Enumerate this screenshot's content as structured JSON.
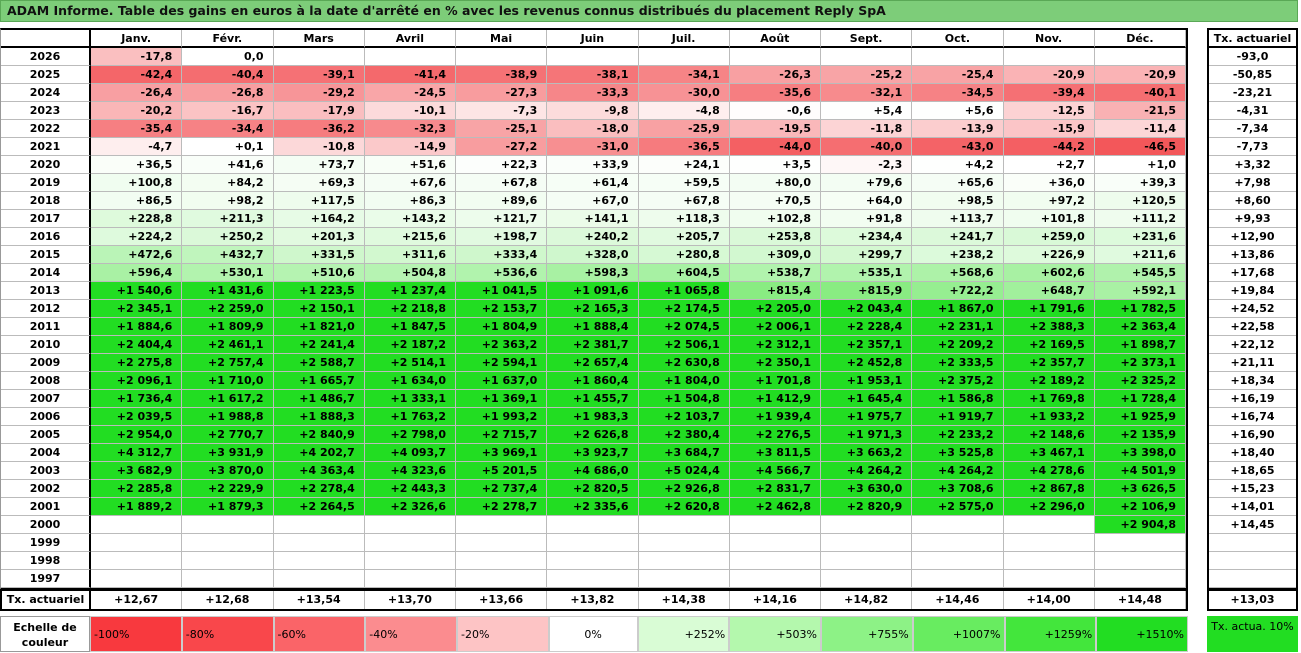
{
  "title": "ADAM Informe. Table des gains en euros à la date d'arrêté en % avec les revenus connus distribués du placement Reply SpA",
  "months": [
    "Janv.",
    "Févr.",
    "Mars",
    "Avril",
    "Mai",
    "Juin",
    "Juil.",
    "Août",
    "Sept.",
    "Oct.",
    "Nov.",
    "Déc."
  ],
  "side_header": "Tx. actuariel",
  "rows": [
    {
      "year": "2026",
      "cells": [
        "-17,8",
        "0,0",
        "",
        "",
        "",
        "",
        "",
        "",
        "",
        "",
        "",
        ""
      ],
      "rate": "-93,0"
    },
    {
      "year": "2025",
      "cells": [
        "-42,4",
        "-40,4",
        "-39,1",
        "-41,4",
        "-38,9",
        "-38,1",
        "-34,1",
        "-26,3",
        "-25,2",
        "-25,4",
        "-20,9",
        "-20,9"
      ],
      "rate": "-50,85"
    },
    {
      "year": "2024",
      "cells": [
        "-26,4",
        "-26,8",
        "-29,2",
        "-24,5",
        "-27,3",
        "-33,3",
        "-30,0",
        "-35,6",
        "-32,1",
        "-34,5",
        "-39,4",
        "-40,1"
      ],
      "rate": "-23,21"
    },
    {
      "year": "2023",
      "cells": [
        "-20,2",
        "-16,7",
        "-17,9",
        "-10,1",
        "-7,3",
        "-9,8",
        "-4,8",
        "-0,6",
        "+5,4",
        "+5,6",
        "-12,5",
        "-21,5"
      ],
      "rate": "-4,31"
    },
    {
      "year": "2022",
      "cells": [
        "-35,4",
        "-34,4",
        "-36,2",
        "-32,3",
        "-25,1",
        "-18,0",
        "-25,9",
        "-19,5",
        "-11,8",
        "-13,9",
        "-15,9",
        "-11,4"
      ],
      "rate": "-7,34"
    },
    {
      "year": "2021",
      "cells": [
        "-4,7",
        "+0,1",
        "-10,8",
        "-14,9",
        "-27,2",
        "-31,0",
        "-36,5",
        "-44,0",
        "-40,0",
        "-43,0",
        "-44,2",
        "-46,5"
      ],
      "rate": "-7,73"
    },
    {
      "year": "2020",
      "cells": [
        "+36,5",
        "+41,6",
        "+73,7",
        "+51,6",
        "+22,3",
        "+33,9",
        "+24,1",
        "+3,5",
        "-2,3",
        "+4,2",
        "+2,7",
        "+1,0"
      ],
      "rate": "+3,32"
    },
    {
      "year": "2019",
      "cells": [
        "+100,8",
        "+84,2",
        "+69,3",
        "+67,6",
        "+67,8",
        "+61,4",
        "+59,5",
        "+80,0",
        "+79,6",
        "+65,6",
        "+36,0",
        "+39,3"
      ],
      "rate": "+7,98"
    },
    {
      "year": "2018",
      "cells": [
        "+86,5",
        "+98,2",
        "+117,5",
        "+86,3",
        "+89,6",
        "+67,0",
        "+67,8",
        "+70,5",
        "+64,0",
        "+98,5",
        "+97,2",
        "+120,5"
      ],
      "rate": "+8,60"
    },
    {
      "year": "2017",
      "cells": [
        "+228,8",
        "+211,3",
        "+164,2",
        "+143,2",
        "+121,7",
        "+141,1",
        "+118,3",
        "+102,8",
        "+91,8",
        "+113,7",
        "+101,8",
        "+111,2"
      ],
      "rate": "+9,93"
    },
    {
      "year": "2016",
      "cells": [
        "+224,2",
        "+250,2",
        "+201,3",
        "+215,6",
        "+198,7",
        "+240,2",
        "+205,7",
        "+253,8",
        "+234,4",
        "+241,7",
        "+259,0",
        "+231,6"
      ],
      "rate": "+12,90"
    },
    {
      "year": "2015",
      "cells": [
        "+472,6",
        "+432,7",
        "+331,5",
        "+311,6",
        "+333,4",
        "+328,0",
        "+280,8",
        "+309,0",
        "+299,7",
        "+238,2",
        "+226,9",
        "+211,6"
      ],
      "rate": "+13,86"
    },
    {
      "year": "2014",
      "cells": [
        "+596,4",
        "+530,1",
        "+510,6",
        "+504,8",
        "+536,6",
        "+598,3",
        "+604,5",
        "+538,7",
        "+535,1",
        "+568,6",
        "+602,6",
        "+545,5"
      ],
      "rate": "+17,68"
    },
    {
      "year": "2013",
      "cells": [
        "+1 540,6",
        "+1 431,6",
        "+1 223,5",
        "+1 237,4",
        "+1 041,5",
        "+1 091,6",
        "+1 065,8",
        "+815,4",
        "+815,9",
        "+722,2",
        "+648,7",
        "+592,1"
      ],
      "rate": "+19,84"
    },
    {
      "year": "2012",
      "cells": [
        "+2 345,1",
        "+2 259,0",
        "+2 150,1",
        "+2 218,8",
        "+2 153,7",
        "+2 165,3",
        "+2 174,5",
        "+2 205,0",
        "+2 043,4",
        "+1 867,0",
        "+1 791,6",
        "+1 782,5"
      ],
      "rate": "+24,52"
    },
    {
      "year": "2011",
      "cells": [
        "+1 884,6",
        "+1 809,9",
        "+1 821,0",
        "+1 847,5",
        "+1 804,9",
        "+1 888,4",
        "+2 074,5",
        "+2 006,1",
        "+2 228,4",
        "+2 231,1",
        "+2 388,3",
        "+2 363,4"
      ],
      "rate": "+22,58"
    },
    {
      "year": "2010",
      "cells": [
        "+2 404,4",
        "+2 461,1",
        "+2 241,4",
        "+2 187,2",
        "+2 363,2",
        "+2 381,7",
        "+2 506,1",
        "+2 312,1",
        "+2 357,1",
        "+2 209,2",
        "+2 169,5",
        "+1 898,7"
      ],
      "rate": "+22,12"
    },
    {
      "year": "2009",
      "cells": [
        "+2 275,8",
        "+2 757,4",
        "+2 588,7",
        "+2 514,1",
        "+2 594,1",
        "+2 657,4",
        "+2 630,8",
        "+2 350,1",
        "+2 452,8",
        "+2 333,5",
        "+2 357,7",
        "+2 373,1"
      ],
      "rate": "+21,11"
    },
    {
      "year": "2008",
      "cells": [
        "+2 096,1",
        "+1 710,0",
        "+1 665,7",
        "+1 634,0",
        "+1 637,0",
        "+1 860,4",
        "+1 804,0",
        "+1 701,8",
        "+1 953,1",
        "+2 375,2",
        "+2 189,2",
        "+2 325,2"
      ],
      "rate": "+18,34"
    },
    {
      "year": "2007",
      "cells": [
        "+1 736,4",
        "+1 617,2",
        "+1 486,7",
        "+1 333,1",
        "+1 369,1",
        "+1 455,7",
        "+1 504,8",
        "+1 412,9",
        "+1 645,4",
        "+1 586,8",
        "+1 769,8",
        "+1 728,4"
      ],
      "rate": "+16,19"
    },
    {
      "year": "2006",
      "cells": [
        "+2 039,5",
        "+1 988,8",
        "+1 888,3",
        "+1 763,2",
        "+1 993,2",
        "+1 983,3",
        "+2 103,7",
        "+1 939,4",
        "+1 975,7",
        "+1 919,7",
        "+1 933,2",
        "+1 925,9"
      ],
      "rate": "+16,74"
    },
    {
      "year": "2005",
      "cells": [
        "+2 954,0",
        "+2 770,7",
        "+2 840,9",
        "+2 798,0",
        "+2 715,7",
        "+2 626,8",
        "+2 380,4",
        "+2 276,5",
        "+1 971,3",
        "+2 233,2",
        "+2 148,6",
        "+2 135,9"
      ],
      "rate": "+16,90"
    },
    {
      "year": "2004",
      "cells": [
        "+4 312,7",
        "+3 931,9",
        "+4 202,7",
        "+4 093,7",
        "+3 969,1",
        "+3 923,7",
        "+3 684,7",
        "+3 811,5",
        "+3 663,2",
        "+3 525,8",
        "+3 467,1",
        "+3 398,0"
      ],
      "rate": "+18,40"
    },
    {
      "year": "2003",
      "cells": [
        "+3 682,9",
        "+3 870,0",
        "+4 363,4",
        "+4 323,6",
        "+5 201,5",
        "+4 686,0",
        "+5 024,4",
        "+4 566,7",
        "+4 264,2",
        "+4 264,2",
        "+4 278,6",
        "+4 501,9"
      ],
      "rate": "+18,65"
    },
    {
      "year": "2002",
      "cells": [
        "+2 285,8",
        "+2 229,9",
        "+2 278,4",
        "+2 443,3",
        "+2 737,4",
        "+2 820,5",
        "+2 926,8",
        "+2 831,7",
        "+3 630,0",
        "+3 708,6",
        "+2 867,8",
        "+3 626,5"
      ],
      "rate": "+15,23"
    },
    {
      "year": "2001",
      "cells": [
        "+1 889,2",
        "+1 879,3",
        "+2 264,5",
        "+2 326,6",
        "+2 278,7",
        "+2 335,6",
        "+2 620,8",
        "+2 462,8",
        "+2 820,9",
        "+2 575,0",
        "+2 296,0",
        "+2 106,9"
      ],
      "rate": "+14,01"
    },
    {
      "year": "2000",
      "cells": [
        "",
        "",
        "",
        "",
        "",
        "",
        "",
        "",
        "",
        "",
        "",
        "+2 904,8"
      ],
      "rate": "+14,45"
    },
    {
      "year": "1999",
      "cells": [
        "",
        "",
        "",
        "",
        "",
        "",
        "",
        "",
        "",
        "",
        "",
        ""
      ],
      "rate": ""
    },
    {
      "year": "1998",
      "cells": [
        "",
        "",
        "",
        "",
        "",
        "",
        "",
        "",
        "",
        "",
        "",
        ""
      ],
      "rate": ""
    },
    {
      "year": "1997",
      "cells": [
        "",
        "",
        "",
        "",
        "",
        "",
        "",
        "",
        "",
        "",
        "",
        ""
      ],
      "rate": ""
    }
  ],
  "footer": {
    "label": "Tx. actuariel",
    "values": [
      "+12,67",
      "+12,68",
      "+13,54",
      "+13,70",
      "+13,66",
      "+13,82",
      "+14,38",
      "+14,16",
      "+14,82",
      "+14,46",
      "+14,00",
      "+14,48"
    ],
    "total": "+13,03"
  },
  "scale": {
    "label": "Echelle de couleur",
    "steps": [
      {
        "text": "-100%",
        "color": "#f8393e",
        "align": "left"
      },
      {
        "text": "-80%",
        "color": "#f9474b",
        "align": "left"
      },
      {
        "text": "-60%",
        "color": "#fa6468",
        "align": "left"
      },
      {
        "text": "-40%",
        "color": "#fb8c8f",
        "align": "left"
      },
      {
        "text": "-20%",
        "color": "#fdc4c5",
        "align": "left"
      },
      {
        "text": "0%",
        "color": "#ffffff",
        "align": "center"
      },
      {
        "text": "+252%",
        "color": "#d9fcd5",
        "align": "right"
      },
      {
        "text": "+503%",
        "color": "#b4f8ad",
        "align": "right"
      },
      {
        "text": "+755%",
        "color": "#8df286",
        "align": "right"
      },
      {
        "text": "+1007%",
        "color": "#68ec60",
        "align": "right"
      },
      {
        "text": "+1259%",
        "color": "#43e63c",
        "align": "right"
      },
      {
        "text": "+1510%",
        "color": "#22dd22",
        "align": "right"
      }
    ],
    "side_text": "Tx. actua. 10%"
  }
}
